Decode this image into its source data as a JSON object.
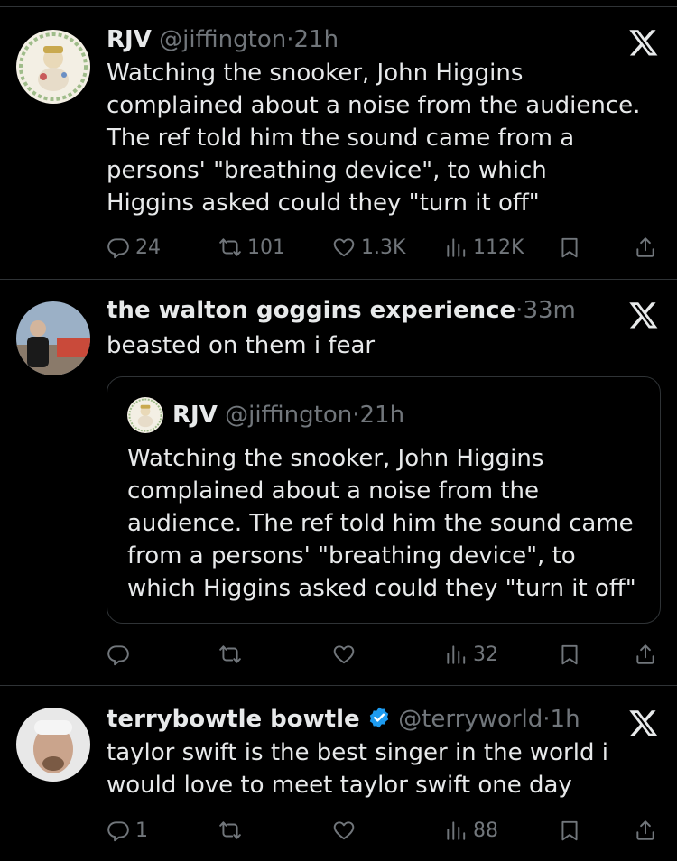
{
  "posts": [
    {
      "name": "RJV",
      "handle": "@jiffington",
      "dot": "·",
      "time": "21h",
      "text": "Watching the snooker, John Higgins complained about a noise from the audience. The ref told him the sound came from a persons' \"breathing device\", to which Higgins asked could they \"turn it off\"",
      "replies": "24",
      "reposts": "101",
      "likes": "1.3K",
      "views": "112K"
    },
    {
      "name": "the walton goggins experience",
      "dot": "·",
      "time": "33m",
      "text": "beasted on them i fear",
      "quote": {
        "name": "RJV",
        "handle": "@jiffington",
        "dot": "·",
        "time": "21h",
        "text": "Watching the snooker, John Higgins complained about a noise from the audience. The ref told him the sound came from a persons' \"breathing device\", to which Higgins asked could they \"turn it off\""
      },
      "views": "32"
    },
    {
      "name": "terrybowtle bowtle",
      "verified": true,
      "handle": "@terryworld",
      "dot": "·",
      "time": "1h",
      "text": "taylor swift is the best singer in the world  i would love to meet taylor swift one day",
      "replies": "1",
      "views": "88"
    }
  ],
  "colors": {
    "background": "#000000",
    "text": "#e7e9ea",
    "muted": "#71767b",
    "divider": "#2f3336",
    "verified": "#1d9bf0"
  },
  "icons": [
    "x-logo-icon",
    "reply-icon",
    "repost-icon",
    "like-icon",
    "views-icon",
    "bookmark-icon",
    "share-icon",
    "verified-badge-icon"
  ]
}
